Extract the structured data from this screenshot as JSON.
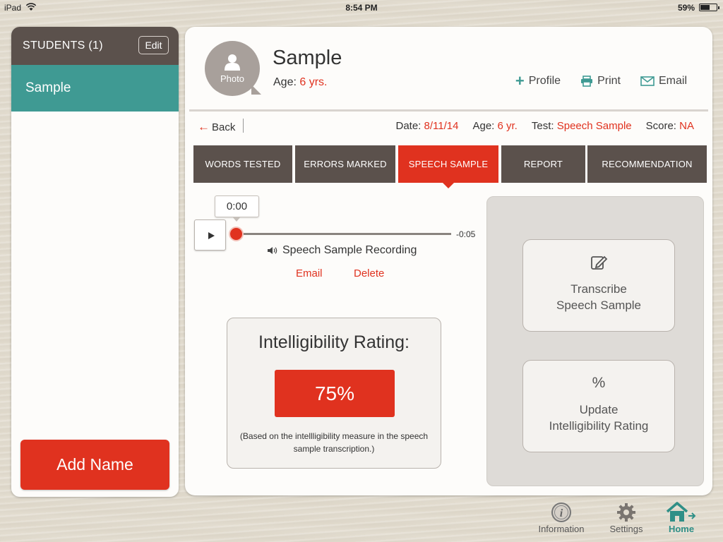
{
  "status_bar": {
    "device": "iPad",
    "time": "8:54 PM",
    "battery": "59%",
    "battery_level": 0.59
  },
  "sidebar": {
    "title": "STUDENTS (1)",
    "edit_label": "Edit",
    "students": [
      "Sample"
    ],
    "add_name_label": "Add Name"
  },
  "profile": {
    "photo_label": "Photo",
    "name": "Sample",
    "age_label": "Age:",
    "age_value": "6 yrs.",
    "actions": {
      "profile": "Profile",
      "print": "Print",
      "email": "Email"
    }
  },
  "info_row": {
    "back_label": "Back",
    "date_label": "Date:",
    "date_value": "8/11/14",
    "age_label": "Age:",
    "age_value": "6 yr.",
    "test_label": "Test:",
    "test_value": "Speech Sample",
    "score_label": "Score:",
    "score_value": "NA"
  },
  "tabs": [
    {
      "label": "WORDS TESTED",
      "active": false
    },
    {
      "label": "ERRORS MARKED",
      "active": false
    },
    {
      "label": "SPEECH SAMPLE",
      "active": true
    },
    {
      "label": "REPORT",
      "active": false
    },
    {
      "label": "RECOMMENDATION",
      "active": false
    }
  ],
  "player": {
    "current_time": "0:00",
    "remaining": "-0:05",
    "progress": 0,
    "recording_label": "Speech Sample Recording",
    "email_label": "Email",
    "delete_label": "Delete"
  },
  "rating": {
    "title": "Intelligibility Rating:",
    "value": "75%",
    "note": "(Based on the intellligibility measure in the speech sample transcription.)"
  },
  "actions_panel": {
    "transcribe_line1": "Transcribe",
    "transcribe_line2": "Speech Sample",
    "percent_glyph": "%",
    "update_line1": "Update",
    "update_line2": "Intelligibility Rating"
  },
  "bottom_nav": {
    "information": "Information",
    "settings": "Settings",
    "home": "Home"
  },
  "colors": {
    "accent": "#e0321f",
    "teal": "#3f9a93",
    "header": "#5b514c"
  }
}
